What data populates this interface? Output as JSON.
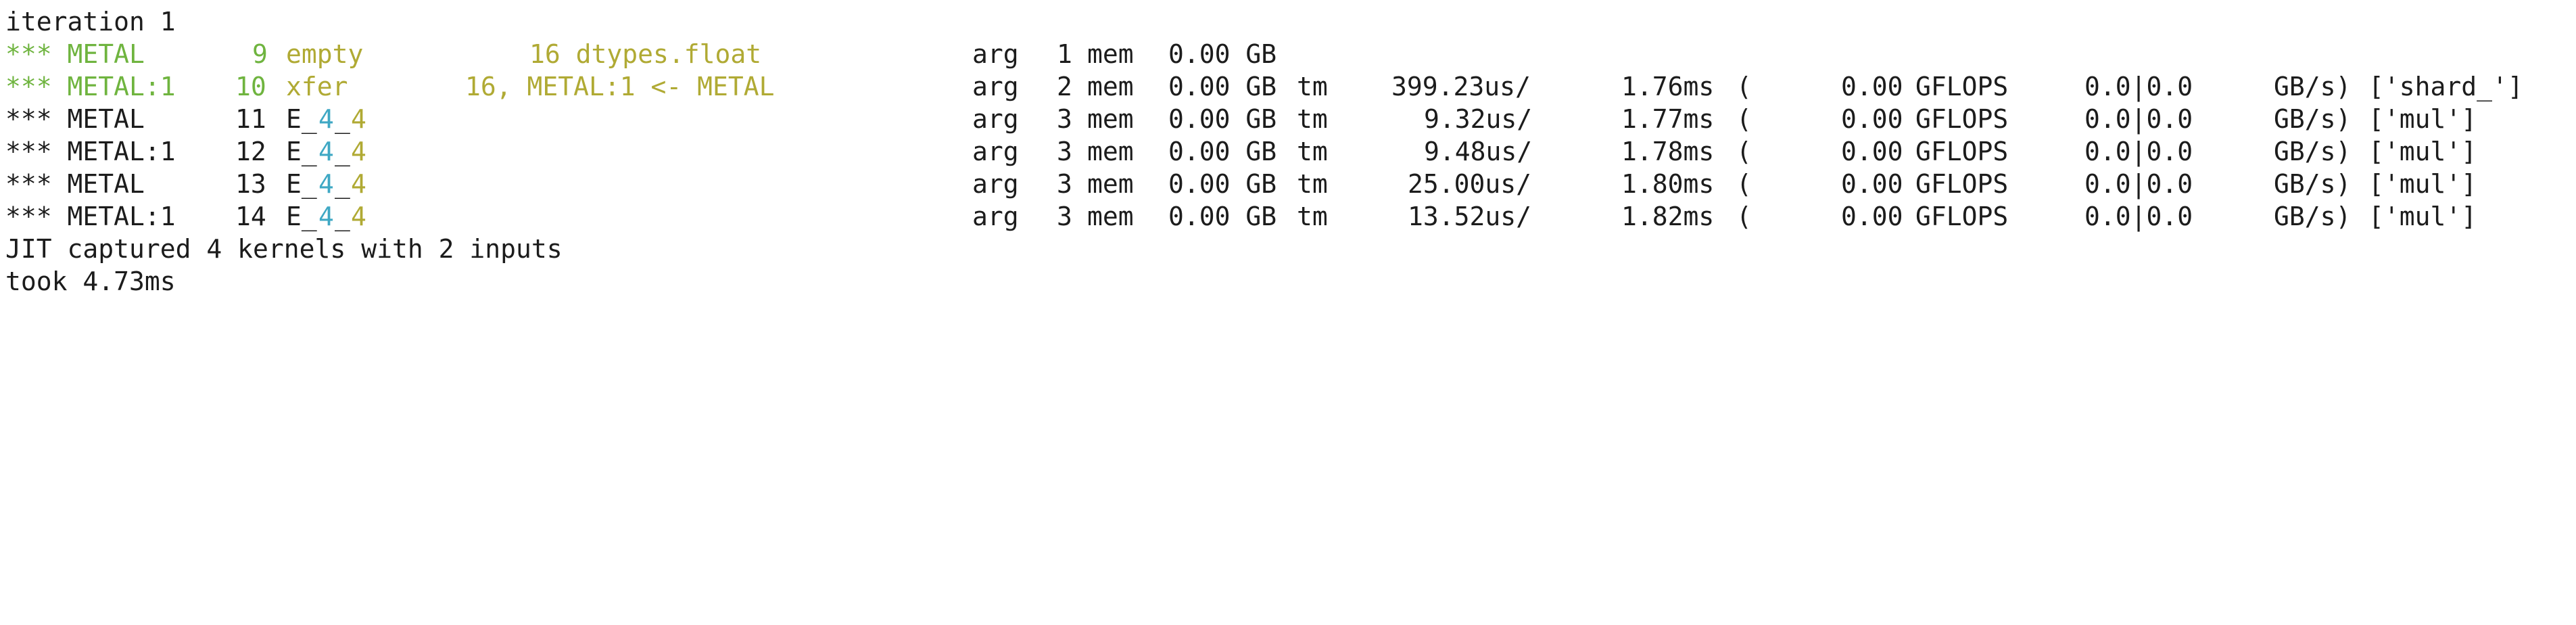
{
  "header": {
    "text": "iteration 1"
  },
  "rows": [
    {
      "prefix": "*** METAL",
      "num": "9",
      "name": "empty",
      "info": "16 dtypes.float",
      "arg": "arg",
      "argn": "1",
      "mem": "mem",
      "memval": "0.00 GB",
      "tm": "",
      "t1": "",
      "t2": "",
      "paren": "",
      "gflops": "",
      "gflopsLabel": "",
      "ratio": "",
      "gbs": "",
      "kernel": "",
      "color": "green"
    },
    {
      "prefix": "*** METAL:1",
      "num": "10",
      "name": "xfer",
      "info": "16, METAL:1 <- METAL",
      "arg": "arg",
      "argn": "2",
      "mem": "mem",
      "memval": "0.00 GB",
      "tm": "tm",
      "t1": "399.23us/",
      "t2": "1.76ms",
      "paren": "(",
      "gflops": "0.00",
      "gflopsLabel": "GFLOPS",
      "ratio": "0.0|0.0",
      "gbs": "GB/s)",
      "kernel": "['shard_']",
      "color": "green"
    },
    {
      "prefix": "*** METAL",
      "num": "11",
      "name_a": "E_",
      "name_b": "4",
      "name_c": "_",
      "name_d": "4",
      "info": "",
      "arg": "arg",
      "argn": "3",
      "mem": "mem",
      "memval": "0.00 GB",
      "tm": "tm",
      "t1": "9.32us/",
      "t2": "1.77ms",
      "paren": "(",
      "gflops": "0.00",
      "gflopsLabel": "GFLOPS",
      "ratio": "0.0|0.0",
      "gbs": "GB/s)",
      "kernel": "['mul']",
      "color": "dark"
    },
    {
      "prefix": "*** METAL:1",
      "num": "12",
      "name_a": "E_",
      "name_b": "4",
      "name_c": "_",
      "name_d": "4",
      "info": "",
      "arg": "arg",
      "argn": "3",
      "mem": "mem",
      "memval": "0.00 GB",
      "tm": "tm",
      "t1": "9.48us/",
      "t2": "1.78ms",
      "paren": "(",
      "gflops": "0.00",
      "gflopsLabel": "GFLOPS",
      "ratio": "0.0|0.0",
      "gbs": "GB/s)",
      "kernel": "['mul']",
      "color": "dark"
    },
    {
      "prefix": "*** METAL",
      "num": "13",
      "name_a": "E_",
      "name_b": "4",
      "name_c": "_",
      "name_d": "4",
      "info": "",
      "arg": "arg",
      "argn": "3",
      "mem": "mem",
      "memval": "0.00 GB",
      "tm": "tm",
      "t1": "25.00us/",
      "t2": "1.80ms",
      "paren": "(",
      "gflops": "0.00",
      "gflopsLabel": "GFLOPS",
      "ratio": "0.0|0.0",
      "gbs": "GB/s)",
      "kernel": "['mul']",
      "color": "dark"
    },
    {
      "prefix": "*** METAL:1",
      "num": "14",
      "name_a": "E_",
      "name_b": "4",
      "name_c": "_",
      "name_d": "4",
      "info": "",
      "arg": "arg",
      "argn": "3",
      "mem": "mem",
      "memval": "0.00 GB",
      "tm": "tm",
      "t1": "13.52us/",
      "t2": "1.82ms",
      "paren": "(",
      "gflops": "0.00",
      "gflopsLabel": "GFLOPS",
      "ratio": "0.0|0.0",
      "gbs": "GB/s)",
      "kernel": "['mul']",
      "color": "dark"
    }
  ],
  "footer": {
    "jit": "JIT captured 4 kernels with 2 inputs",
    "took": "took 4.73ms"
  },
  "colors": {
    "green": "#6fb43f",
    "olive": "#b0aa34",
    "cyan": "#3fa8c4",
    "text": "#1c1c1c",
    "background": "#ffffff"
  }
}
